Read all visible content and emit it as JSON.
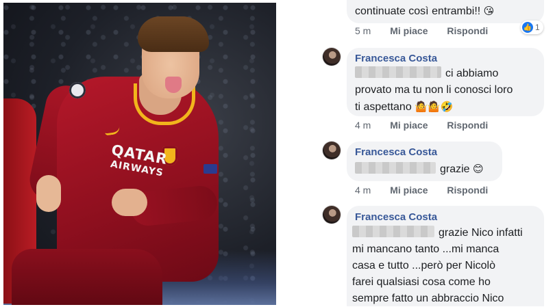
{
  "photo": {
    "sponsor_line1": "QATAR",
    "sponsor_line2": "AIRWAYS"
  },
  "comments": [
    {
      "author": "",
      "text": "continuate così entrambi!!",
      "emoji": "😘",
      "time": "5 m",
      "like_label": "Mi piace",
      "reply_label": "Rispondi",
      "reaction_count": "1",
      "reaction_icon": "thumbs-up-icon"
    },
    {
      "author": "Francesca Costa",
      "text_line1": "ci abbiamo",
      "text_line2": "provato ma tu non li conosci loro",
      "text_line3": "ti aspettano",
      "emoji": "🤷🤷🤣",
      "time": "4 m",
      "like_label": "Mi piace",
      "reply_label": "Rispondi"
    },
    {
      "author": "Francesca Costa",
      "text": "grazie",
      "emoji": "😊",
      "time": "4 m",
      "like_label": "Mi piace",
      "reply_label": "Rispondi"
    },
    {
      "author": "Francesca Costa",
      "text_line1": "grazie Nico infatti",
      "text_line2": "mi mancano tanto ...mi manca",
      "text_line3": "casa e tutto ...però per Nicolò",
      "text_line4": "farei qualsiasi cosa come ho",
      "text_line5": "sempre fatto un abbraccio Nico"
    }
  ],
  "colors": {
    "name": "#385898",
    "bubble": "#f2f3f5",
    "meta": "#606770",
    "like": "#1877f2"
  }
}
